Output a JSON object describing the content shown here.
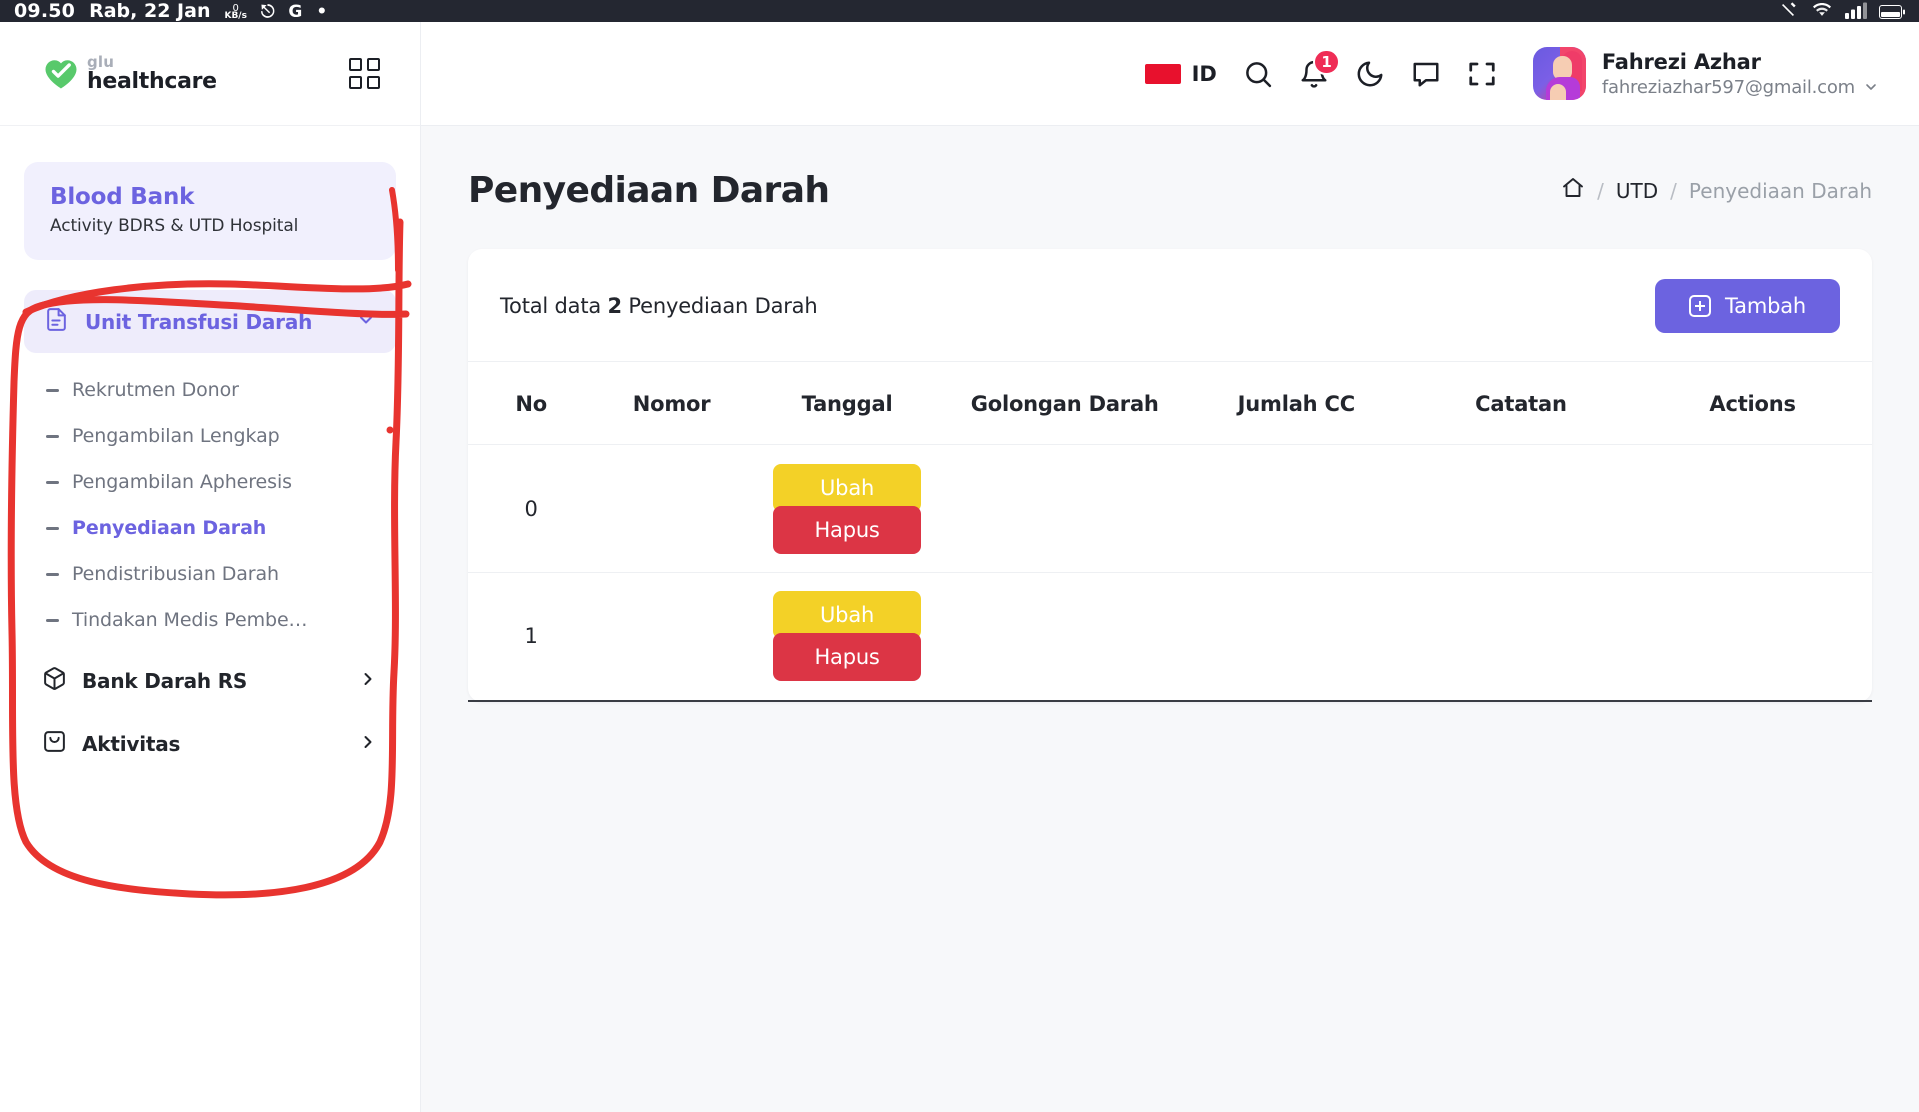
{
  "statusbar": {
    "time": "09.50",
    "date": "Rab, 22 Jan",
    "net_rate": "KB/s",
    "net_arrow": "0",
    "whatsapp_icon": "whatsapp-icon",
    "google_icon": "google-icon",
    "dot_icon": "dot-icon",
    "mute_icon": "mute-icon",
    "wifi_icon": "wifi-icon",
    "signal_icon": "signal-icon",
    "battery_icon": "battery-icon"
  },
  "brand": {
    "small": "glu",
    "name": "healthcare",
    "logo_icon": "heart-check-icon",
    "grid_icon": "grid-apps-icon"
  },
  "sidebar": {
    "bank_card": {
      "title": "Blood Bank",
      "subtitle": "Activity BDRS & UTD Hospital"
    },
    "group": {
      "label": "Unit Transfusi Darah",
      "icon": "document-icon",
      "chevron": "chevron-down-icon"
    },
    "sub_items": [
      {
        "label": "Rekrutmen Donor",
        "active": false
      },
      {
        "label": "Pengambilan Lengkap",
        "active": false
      },
      {
        "label": "Pengambilan Apheresis",
        "active": false
      },
      {
        "label": "Penyediaan Darah",
        "active": true
      },
      {
        "label": "Pendistribusian Darah",
        "active": false
      },
      {
        "label": "Tindakan Medis Pembe…",
        "active": false
      }
    ],
    "items": [
      {
        "label": "Bank Darah RS",
        "icon": "box-icon",
        "chevron": "chevron-right-icon"
      },
      {
        "label": "Aktivitas",
        "icon": "inbox-icon",
        "chevron": "chevron-right-icon"
      }
    ]
  },
  "topbar": {
    "language": "ID",
    "flag_icon": "indonesia-flag-icon",
    "search_icon": "search-icon",
    "bell_icon": "bell-icon",
    "notification_count": "1",
    "moon_icon": "moon-icon",
    "chat_icon": "chat-bubble-icon",
    "fullscreen_icon": "fullscreen-icon",
    "avatar_icon": "user-avatar",
    "user_name": "Fahrezi Azhar",
    "user_email": "fahreziazhar597@gmail.com",
    "user_chevron": "chevron-down-icon"
  },
  "page": {
    "title": "Penyediaan Darah",
    "breadcrumb": {
      "home_icon": "home-icon",
      "sep": "/",
      "parent": "UTD",
      "current": "Penyediaan Darah"
    }
  },
  "card": {
    "total_prefix": "Total data",
    "total_count": "2",
    "total_suffix": "Penyediaan Darah",
    "add_button": "Tambah",
    "add_icon": "plus-square-icon"
  },
  "table": {
    "columns": [
      "No",
      "Nomor",
      "Tanggal",
      "Golongan Darah",
      "Jumlah CC",
      "Catatan",
      "Actions"
    ],
    "rows": [
      {
        "no": "0",
        "nomor": "",
        "tanggal": "",
        "golongan_darah": "",
        "jumlah_cc": "",
        "catatan": "",
        "edit_label": "Ubah",
        "delete_label": "Hapus"
      },
      {
        "no": "1",
        "nomor": "",
        "tanggal": "",
        "golongan_darah": "",
        "jumlah_cc": "",
        "catatan": "",
        "edit_label": "Ubah",
        "delete_label": "Hapus"
      }
    ]
  },
  "annotation": {
    "type": "hand-drawn-circle",
    "color": "#e8342f"
  },
  "colors": {
    "accent": "#6c63e0",
    "accent_bg": "#f1f0fd",
    "edit": "#f3d127",
    "delete": "#dc3545",
    "badge": "#ef2d56",
    "flag": "#e8112d",
    "annotation": "#e8342f"
  }
}
